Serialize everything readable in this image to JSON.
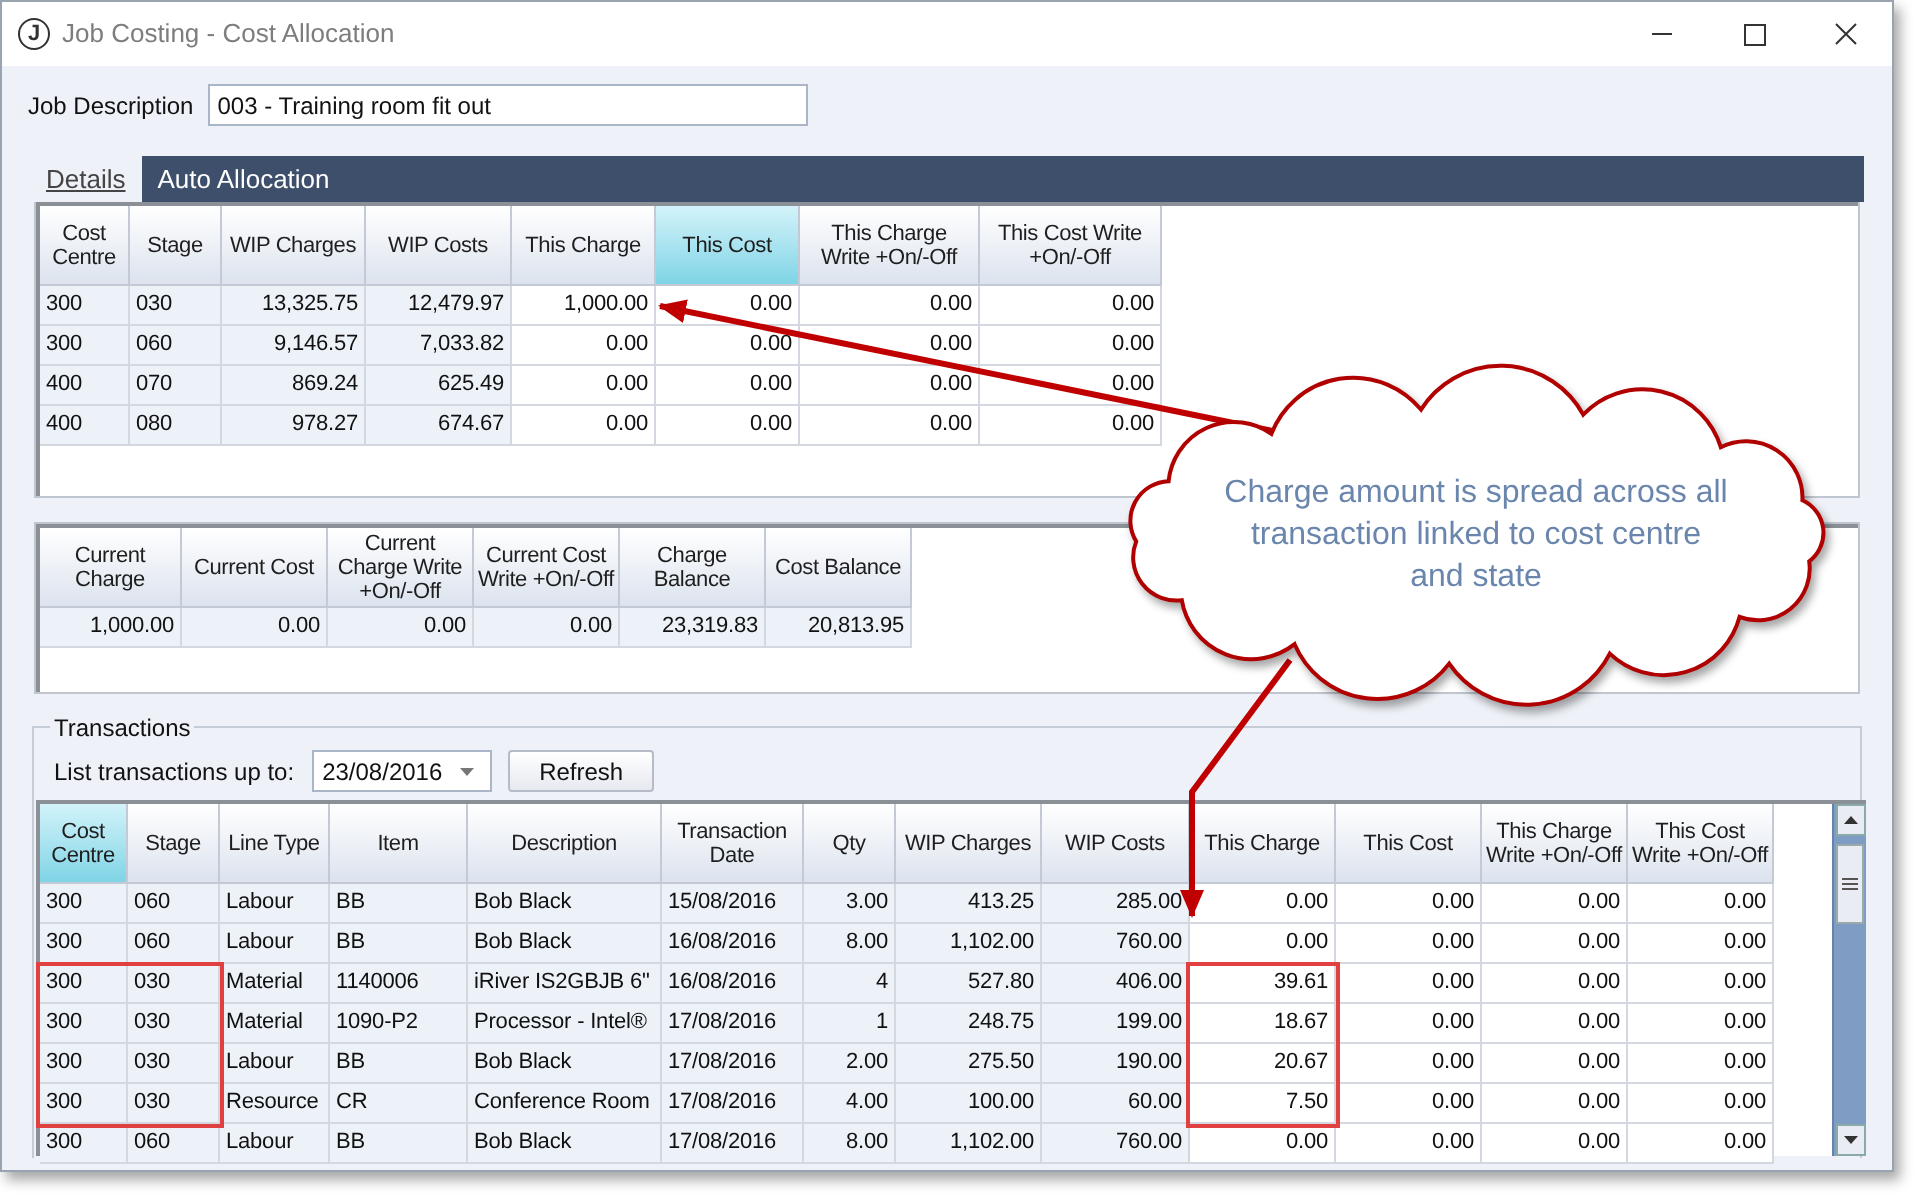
{
  "window": {
    "title": "Job Costing - Cost Allocation",
    "logo": "J"
  },
  "job_description": {
    "label": "Job Description",
    "value": "003 - Training room fit out"
  },
  "tabs": [
    {
      "label": "Details",
      "selected": true
    },
    {
      "label": "Auto Allocation",
      "selected": false
    }
  ],
  "stage_grid": {
    "columns": [
      {
        "label": "Cost Centre",
        "kind": "text",
        "editable": false,
        "selected": false
      },
      {
        "label": "Stage",
        "kind": "text",
        "editable": false,
        "selected": false
      },
      {
        "label": "WIP Charges",
        "kind": "number",
        "editable": false,
        "selected": false
      },
      {
        "label": "WIP Costs",
        "kind": "number",
        "editable": false,
        "selected": false
      },
      {
        "label": "This Charge",
        "kind": "number",
        "editable": true,
        "selected": false
      },
      {
        "label": "This Cost",
        "kind": "number",
        "editable": true,
        "selected": true
      },
      {
        "label": "This Charge Write +On/-Off",
        "kind": "number",
        "editable": true,
        "selected": false
      },
      {
        "label": "This Cost Write +On/-Off",
        "kind": "number",
        "editable": true,
        "selected": false
      }
    ],
    "rows": [
      [
        "300",
        "030",
        "13,325.75",
        "12,479.97",
        "1,000.00",
        "0.00",
        "0.00",
        "0.00"
      ],
      [
        "300",
        "060",
        "9,146.57",
        "7,033.82",
        "0.00",
        "0.00",
        "0.00",
        "0.00"
      ],
      [
        "400",
        "070",
        "869.24",
        "625.49",
        "0.00",
        "0.00",
        "0.00",
        "0.00"
      ],
      [
        "400",
        "080",
        "978.27",
        "674.67",
        "0.00",
        "0.00",
        "0.00",
        "0.00"
      ]
    ]
  },
  "totals_grid": {
    "columns": [
      {
        "label": "Current Charge",
        "kind": "number",
        "editable": false,
        "selected": false
      },
      {
        "label": "Current Cost",
        "kind": "number",
        "editable": false,
        "selected": false
      },
      {
        "label": "Current Charge Write +On/-Off",
        "kind": "number",
        "editable": false,
        "selected": false
      },
      {
        "label": "Current Cost Write +On/-Off",
        "kind": "number",
        "editable": false,
        "selected": false
      },
      {
        "label": "Charge Balance",
        "kind": "number",
        "editable": false,
        "selected": false
      },
      {
        "label": "Cost Balance",
        "kind": "number",
        "editable": false,
        "selected": false
      }
    ],
    "rows": [
      [
        "1,000.00",
        "0.00",
        "0.00",
        "0.00",
        "23,319.83",
        "20,813.95"
      ]
    ]
  },
  "transactions": {
    "title": "Transactions",
    "filter_label": "List transactions up to:",
    "date": "23/08/2016",
    "refresh_button": "Refresh",
    "grid": {
      "columns": [
        {
          "label": "Cost Centre",
          "kind": "text",
          "editable": false,
          "selected": true
        },
        {
          "label": "Stage",
          "kind": "text",
          "editable": false,
          "selected": false
        },
        {
          "label": "Line Type",
          "kind": "text",
          "editable": false,
          "selected": false
        },
        {
          "label": "Item",
          "kind": "text",
          "editable": false,
          "selected": false
        },
        {
          "label": "Description",
          "kind": "text",
          "editable": false,
          "selected": false
        },
        {
          "label": "Transaction Date",
          "kind": "text",
          "editable": false,
          "selected": false
        },
        {
          "label": "Qty",
          "kind": "number",
          "editable": false,
          "selected": false
        },
        {
          "label": "WIP Charges",
          "kind": "number",
          "editable": false,
          "selected": false
        },
        {
          "label": "WIP Costs",
          "kind": "number",
          "editable": false,
          "selected": false
        },
        {
          "label": "This Charge",
          "kind": "number",
          "editable": true,
          "selected": false
        },
        {
          "label": "This Cost",
          "kind": "number",
          "editable": true,
          "selected": false
        },
        {
          "label": "This Charge Write +On/-Off",
          "kind": "number",
          "editable": true,
          "selected": false
        },
        {
          "label": "This Cost Write +On/-Off",
          "kind": "number",
          "editable": true,
          "selected": false
        }
      ],
      "rows": [
        [
          "300",
          "060",
          "Labour",
          "BB",
          "Bob Black",
          "15/08/2016",
          "3.00",
          "413.25",
          "285.00",
          "0.00",
          "0.00",
          "0.00",
          "0.00"
        ],
        [
          "300",
          "060",
          "Labour",
          "BB",
          "Bob Black",
          "16/08/2016",
          "8.00",
          "1,102.00",
          "760.00",
          "0.00",
          "0.00",
          "0.00",
          "0.00"
        ],
        [
          "300",
          "030",
          "Material",
          "1140006",
          "iRiver IS2GBJB 6\"",
          "16/08/2016",
          "4",
          "527.80",
          "406.00",
          "39.61",
          "0.00",
          "0.00",
          "0.00"
        ],
        [
          "300",
          "030",
          "Material",
          "1090-P2",
          "Processor - Intel®",
          "17/08/2016",
          "1",
          "248.75",
          "199.00",
          "18.67",
          "0.00",
          "0.00",
          "0.00"
        ],
        [
          "300",
          "030",
          "Labour",
          "BB",
          "Bob Black",
          "17/08/2016",
          "2.00",
          "275.50",
          "190.00",
          "20.67",
          "0.00",
          "0.00",
          "0.00"
        ],
        [
          "300",
          "030",
          "Resource",
          "CR",
          "Conference Room",
          "17/08/2016",
          "4.00",
          "100.00",
          "60.00",
          "7.50",
          "0.00",
          "0.00",
          "0.00"
        ],
        [
          "300",
          "060",
          "Labour",
          "BB",
          "Bob Black",
          "17/08/2016",
          "8.00",
          "1,102.00",
          "760.00",
          "0.00",
          "0.00",
          "0.00",
          "0.00"
        ]
      ]
    }
  },
  "callout": {
    "text": "Charge amount is spread across all transaction linked to cost centre and state"
  }
}
